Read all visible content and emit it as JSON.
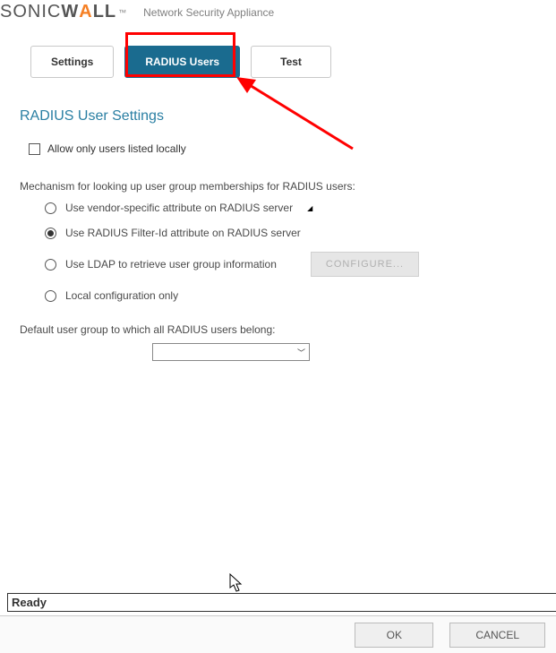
{
  "header": {
    "brand_prefix": "SONIC",
    "brand_suffix": "W",
    "brand_a": "A",
    "brand_end": "LL",
    "subtitle": "Network Security Appliance"
  },
  "tabs": {
    "settings": "Settings",
    "radius_users": "RADIUS Users",
    "test": "Test"
  },
  "section": {
    "title": "RADIUS User Settings",
    "allow_local": "Allow only users listed locally",
    "mechanism_label": "Mechanism for looking up user group memberships for RADIUS users:",
    "options": {
      "vendor": "Use vendor-specific attribute on RADIUS server",
      "filter_id": "Use RADIUS Filter-Id attribute on RADIUS server",
      "ldap": "Use LDAP to retrieve user group information",
      "local": "Local configuration only"
    },
    "configure_btn": "CONFIGURE...",
    "default_group_label": "Default user group to which all RADIUS users belong:"
  },
  "status": "Ready",
  "footer": {
    "ok": "OK",
    "cancel": "CANCEL"
  }
}
